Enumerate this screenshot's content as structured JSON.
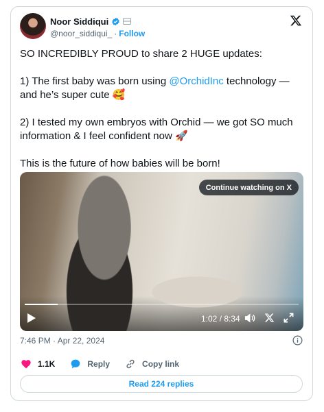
{
  "author": {
    "name": "Noor Siddiqui",
    "handle": "@noor_siddiqui_",
    "separator": "·",
    "follow_label": "Follow"
  },
  "tweet": {
    "line1": "SO INCREDIBLY PROUD to share 2 HUGE updates:",
    "line2_pre": "1) The first baby was born using ",
    "line2_mention": "@OrchidInc",
    "line2_post": " technology — and he’s super cute 🥰",
    "line3": "2) I tested my own embryos with Orchid — we got SO much information & I feel confident now 🚀",
    "line4": "This is the future of how babies will be born!"
  },
  "video": {
    "continue_label": "Continue watching on X",
    "time": "1:02 / 8:34",
    "progress": 0.12
  },
  "timestamp": "7:46 PM · Apr 22, 2024",
  "actions": {
    "likes": "1.1K",
    "reply_label": "Reply",
    "copy_label": "Copy link"
  },
  "read_replies_label": "Read 224 replies",
  "colors": {
    "accent": "#1d9bf0",
    "like": "#f91880",
    "text": "#0f1419",
    "muted": "#536471"
  }
}
